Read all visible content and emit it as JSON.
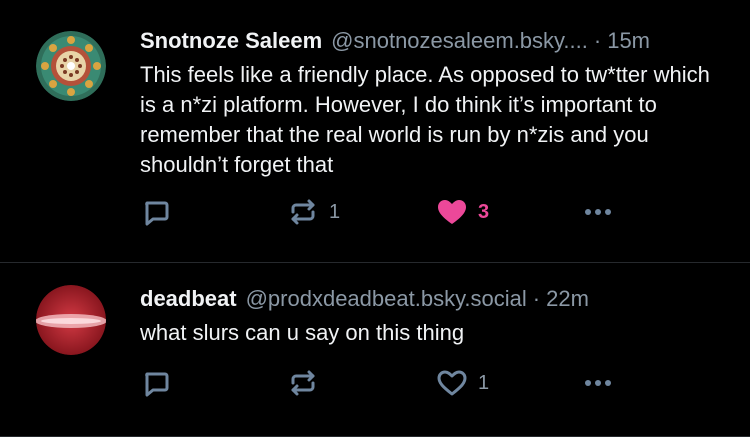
{
  "posts": [
    {
      "display_name": "Snotnoze Saleem",
      "handle": "@snotnozesaleem.bsky....",
      "separator": "·",
      "time": "15m",
      "text": "This feels like a friendly place. As opposed to tw*tter which is a n*zi platform. However, I do think it’s important to remember that the real world is run by n*zis and you shouldn’t forget that",
      "reply_count": "",
      "repost_count": "1",
      "like_count": "3",
      "liked": true,
      "avatar": "mosaic-pattern"
    },
    {
      "display_name": "deadbeat",
      "handle": "@prodxdeadbeat.bsky.social",
      "separator": "·",
      "time": "22m",
      "text": "what slurs can u say on this thing",
      "reply_count": "",
      "repost_count": "",
      "like_count": "1",
      "liked": false,
      "avatar": "red-blur"
    }
  ],
  "icons": {
    "reply": "speech-bubble-icon",
    "repost": "repost-arrows-icon",
    "like": "heart-icon",
    "more": "ellipsis-icon"
  },
  "colors": {
    "background": "#000000",
    "text": "#f1f3f5",
    "muted": "#8b98a5",
    "icon": "#6f869f",
    "like": "#ec4899",
    "divider": "#26292d"
  }
}
